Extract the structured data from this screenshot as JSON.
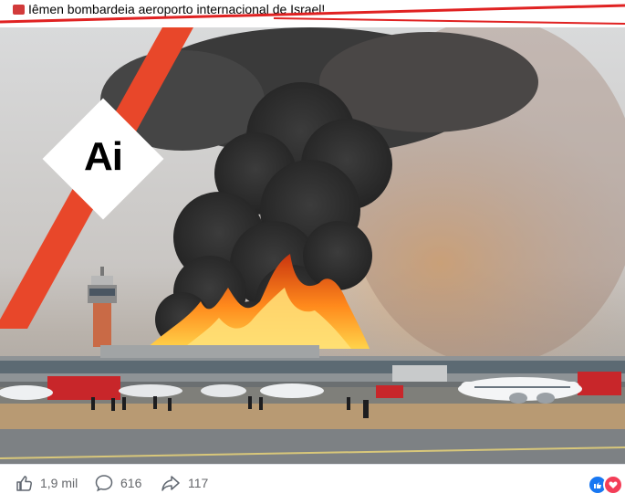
{
  "post": {
    "caption": "Iêmen bombardeia aeroporto internacional de Israel!",
    "flag_icon": "yemen-flag-icon"
  },
  "image": {
    "badge_text": "Ai",
    "accent_color": "#e8472a"
  },
  "actions": {
    "likes": "1,9 mil",
    "comments": "616",
    "shares": "117"
  },
  "reactions": [
    "like",
    "love"
  ]
}
